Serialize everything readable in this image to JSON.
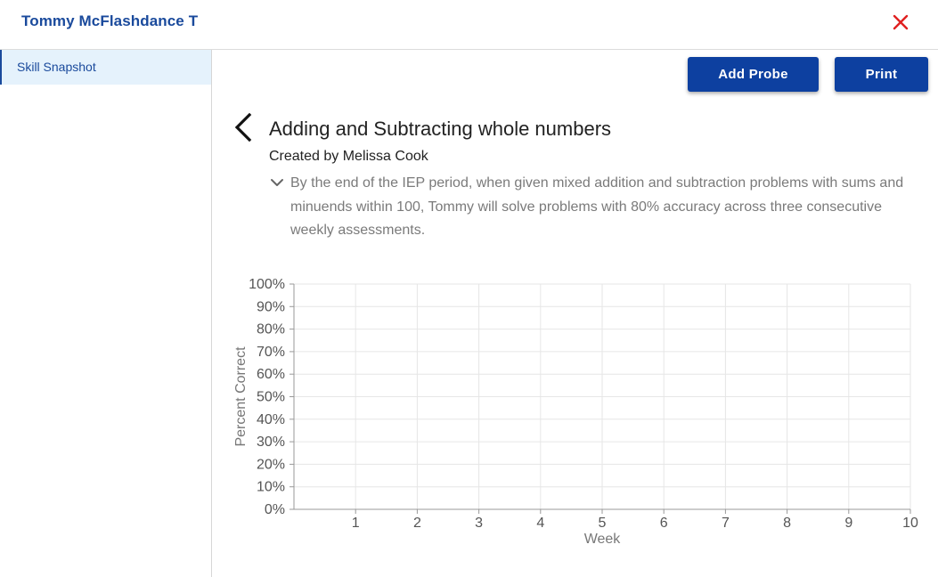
{
  "header": {
    "title": "Tommy McFlashdance T",
    "close_icon": "close-icon",
    "close_color": "#e02020"
  },
  "sidebar": {
    "items": [
      {
        "label": "Skill Snapshot",
        "active": true
      }
    ]
  },
  "toolbar": {
    "add_probe_label": "Add Probe",
    "print_label": "Print"
  },
  "goal": {
    "back_icon": "chevron-left-icon",
    "title": "Adding and Subtracting whole numbers",
    "author": "Created by Melissa Cook",
    "expand_icon": "chevron-down-icon",
    "description": "By the end of the IEP period, when given mixed addition and subtraction problems with sums and minuends within 100, Tommy will solve problems with 80% accuracy across three consecutive weekly assessments."
  },
  "colors": {
    "brand": "#1a4a9c",
    "button": "#0d40a0",
    "sidebar_active_bg": "#e5f2fc",
    "grid": "#e6e6e6",
    "axis": "#999999",
    "tick_text": "#555555"
  },
  "chart_data": {
    "type": "line",
    "xlabel": "Week",
    "ylabel": "Percent Correct",
    "xlim": [
      0,
      10
    ],
    "ylim": [
      0,
      100
    ],
    "x_ticks": [
      "1",
      "2",
      "3",
      "4",
      "5",
      "6",
      "7",
      "8",
      "9",
      "10"
    ],
    "y_ticks": [
      "0%",
      "10%",
      "20%",
      "30%",
      "40%",
      "50%",
      "60%",
      "70%",
      "80%",
      "90%",
      "100%"
    ],
    "grid": true,
    "series": []
  }
}
